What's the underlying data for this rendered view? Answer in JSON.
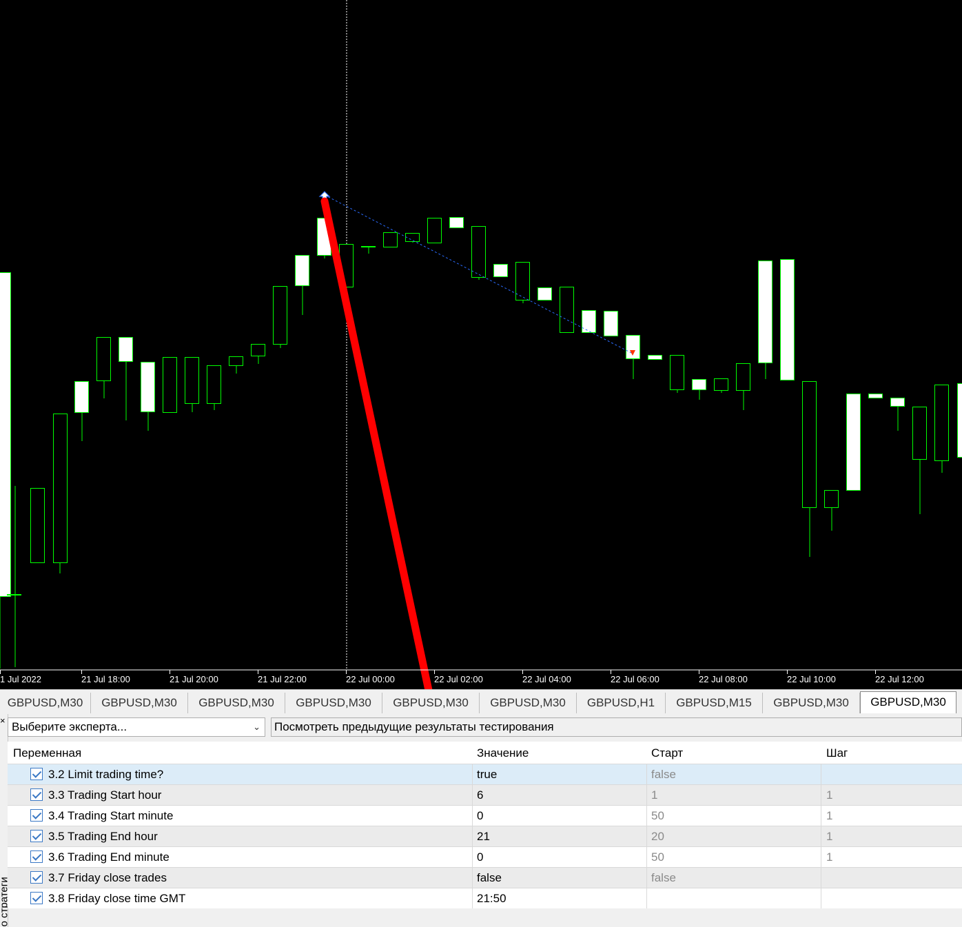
{
  "chart": {
    "symbol": "GBPUSD",
    "timeframe": "M30",
    "background": "#000000",
    "candle_border_color": "#00ff00",
    "bull_fill": "#000000",
    "bear_fill": "#ffffff",
    "time_labels": [
      "1 Jul 2022",
      "21 Jul 18:00",
      "21 Jul 20:00",
      "21 Jul 22:00",
      "22 Jul 00:00",
      "22 Jul 02:00",
      "22 Jul 04:00",
      "22 Jul 06:00",
      "22 Jul 08:00",
      "22 Jul 10:00",
      "22 Jul 12:00"
    ],
    "annotation_arrow_color": "#ff0000",
    "trade_line_color": "#2a6cff"
  },
  "tabs": [
    "GBPUSD,M30",
    "GBPUSD,M30",
    "GBPUSD,M30",
    "GBPUSD,M30",
    "GBPUSD,M30",
    "GBPUSD,M30",
    "GBPUSD,H1",
    "GBPUSD,M15",
    "GBPUSD,M30",
    "GBPUSD,M30"
  ],
  "active_tab_index": 9,
  "tester": {
    "close_glyph": "×",
    "side_label": "о стратеги",
    "expert_select": "Выберите эксперта...",
    "prev_results_button": "Посмотреть предыдущие результаты тестирования",
    "columns": [
      "Переменная",
      "Значение",
      "Старт",
      "Шаг"
    ],
    "rows": [
      {
        "name": "3.2 Limit trading time?",
        "value": "true",
        "start": "false",
        "step": "",
        "checked": true
      },
      {
        "name": "3.3 Trading Start hour",
        "value": "6",
        "start": "1",
        "step": "1",
        "checked": true
      },
      {
        "name": "3.4 Trading Start minute",
        "value": "0",
        "start": "50",
        "step": "1",
        "checked": true
      },
      {
        "name": "3.5 Trading End hour",
        "value": "21",
        "start": "20",
        "step": "1",
        "checked": true
      },
      {
        "name": "3.6 Trading End minute",
        "value": "0",
        "start": "50",
        "step": "1",
        "checked": true
      },
      {
        "name": "3.7 Friday close trades",
        "value": "false",
        "start": "false",
        "step": "",
        "checked": true
      },
      {
        "name": "3.8 Friday close time GMT",
        "value": "21:50",
        "start": "",
        "step": "",
        "checked": true
      }
    ]
  }
}
